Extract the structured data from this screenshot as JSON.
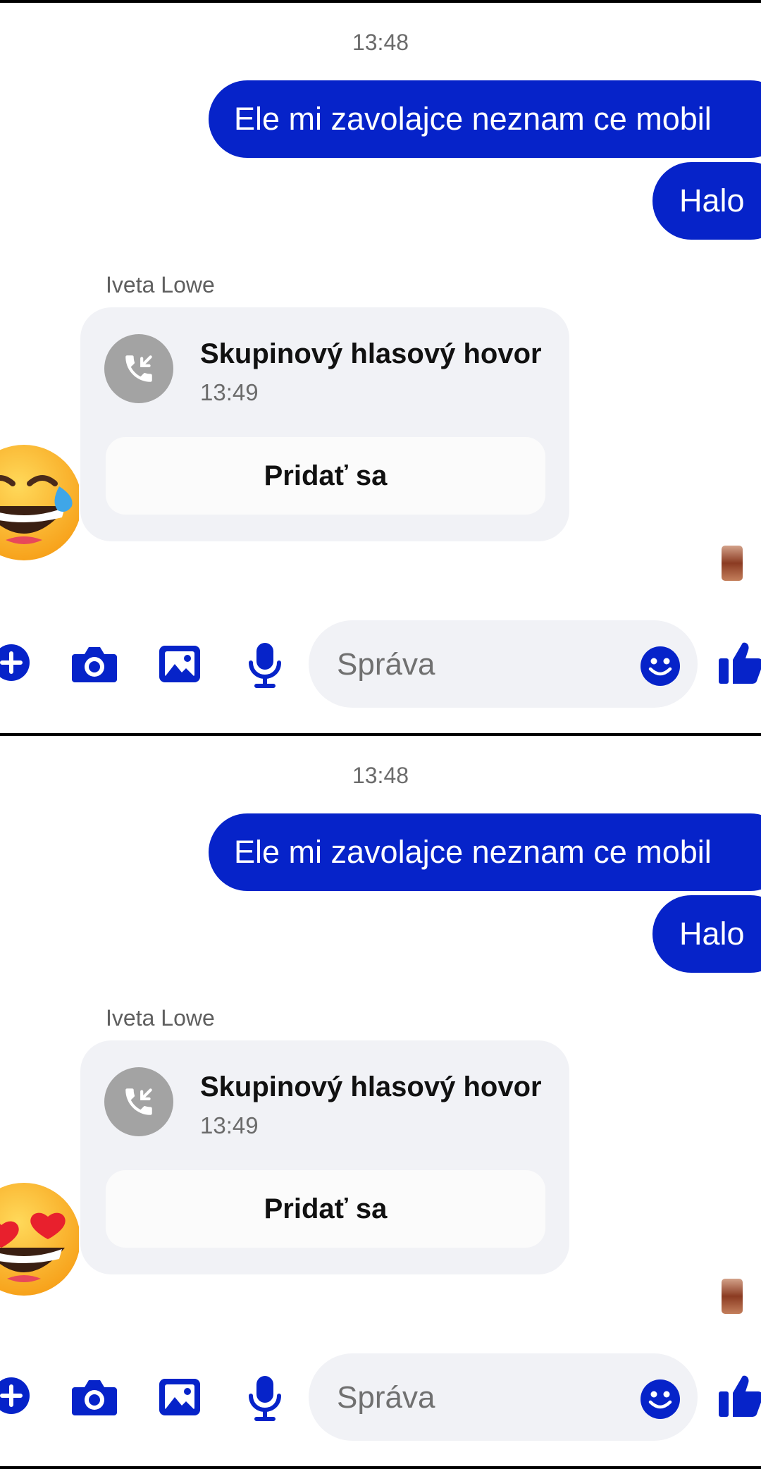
{
  "conversation": {
    "timestamp": "13:48",
    "outgoing": [
      {
        "text": "Ele mi zavolajce neznam ce mobil"
      },
      {
        "text": "Halo"
      }
    ],
    "sender": "Iveta Lowe",
    "call": {
      "title": "Skupinový hlasový hovor",
      "time": "13:49",
      "join_label": "Pridať sa"
    }
  },
  "composer": {
    "placeholder": "Správa"
  },
  "reactions": [
    "😂",
    "😍"
  ],
  "icons": {
    "add": "plus-circle-icon",
    "camera": "camera-icon",
    "gallery": "image-icon",
    "voice": "microphone-icon",
    "emoji": "smiley-icon",
    "like": "thumbs-up-icon",
    "call": "missed-call-icon"
  },
  "colors": {
    "accent": "#0623c9",
    "bubble_out": "#0623c9",
    "card_bg": "#f1f2f6",
    "call_icon_bg": "#a3a3a3"
  }
}
